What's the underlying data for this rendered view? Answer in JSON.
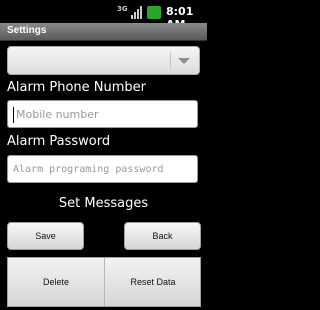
{
  "status_bar": {
    "network": "3G",
    "time": "8:01 AM"
  },
  "title_bar": {
    "title": "Settings"
  },
  "spinner": {
    "selected": ""
  },
  "alarm_phone": {
    "label": "Alarm Phone Number",
    "placeholder": "Mobile number"
  },
  "alarm_password": {
    "label": "Alarm Password",
    "placeholder": "Alarm programing password"
  },
  "messages": {
    "heading": "Set Messages"
  },
  "buttons": {
    "save": "Save",
    "back": "Back",
    "delete": "Delete",
    "reset": "Reset Data"
  },
  "colors": {
    "battery": "#2aa52a"
  }
}
